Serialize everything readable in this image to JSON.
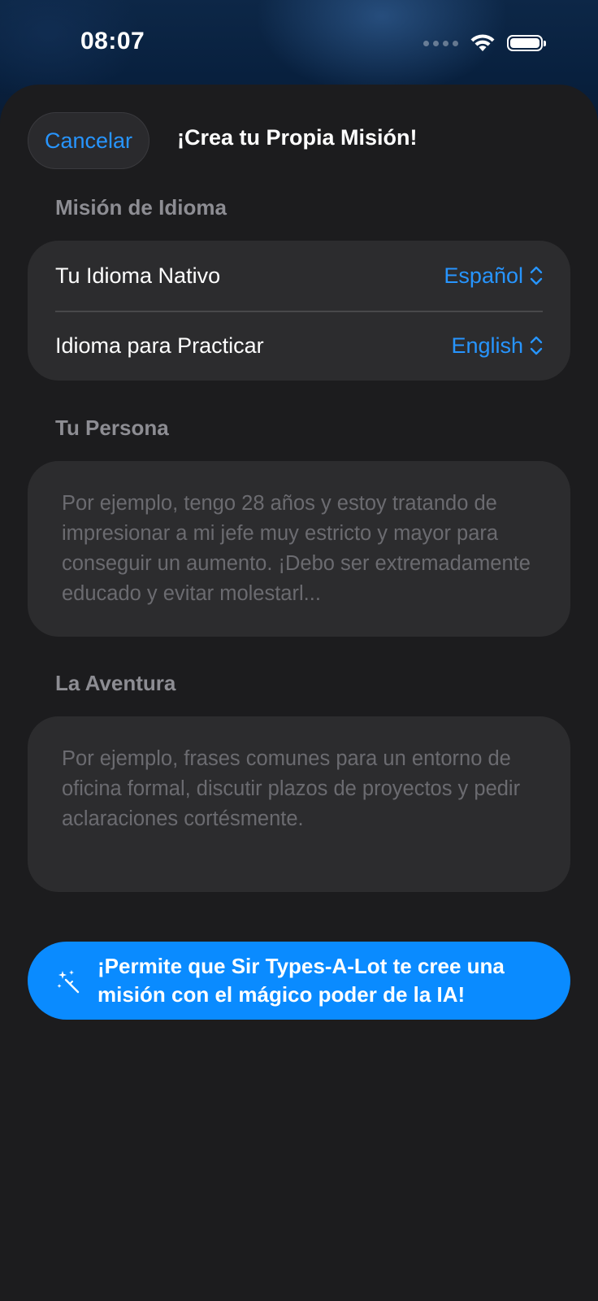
{
  "status_bar": {
    "time": "08:07"
  },
  "header": {
    "cancel_label": "Cancelar",
    "title": "¡Crea tu Propia Misión!"
  },
  "language_section": {
    "label": "Misión de Idioma",
    "rows": [
      {
        "label": "Tu Idioma Nativo",
        "value": "Español"
      },
      {
        "label": "Idioma para Practicar",
        "value": "English"
      }
    ]
  },
  "persona_section": {
    "label": "Tu Persona",
    "placeholder": "Por ejemplo, tengo 28 años y estoy tratando de impresionar a mi jefe muy estricto y mayor para conseguir un aumento. ¡Debo ser extremadamente educado y evitar molestarl..."
  },
  "adventure_section": {
    "label": "La Aventura",
    "placeholder": "Por ejemplo, frases comunes para un entorno de oficina formal, discutir plazos de proyectos y pedir aclaraciones cortésmente."
  },
  "ai_button": {
    "label": "¡Permite que Sir Types-A-Lot te cree una misión con el mágico poder de la IA!",
    "icon": "magic-wand-icon"
  },
  "colors": {
    "accent": "#2795ff",
    "button": "#0a8bff",
    "sheet": "#1c1c1e",
    "card": "#2c2c2e"
  }
}
